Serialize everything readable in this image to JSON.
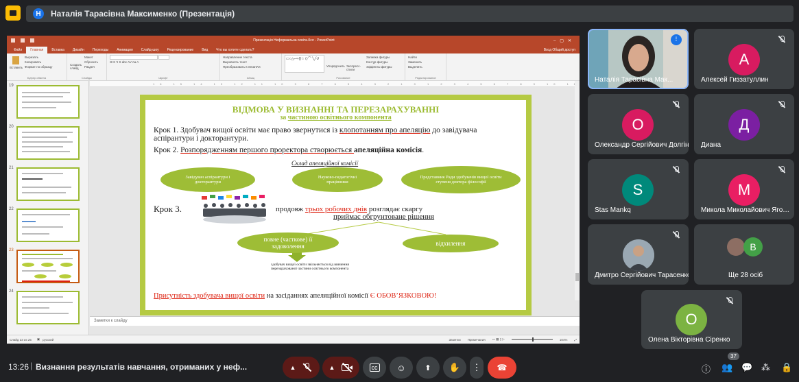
{
  "presenter": {
    "initial": "Н",
    "title": "Наталія Тарасівна Максименко (Презентація)"
  },
  "ppt": {
    "doc_title": "Презентація Неформальна освіта.Ксл - PowerPoint",
    "tabs": [
      "Файл",
      "Главная",
      "Вставка",
      "Дизайн",
      "Переходы",
      "Анимация",
      "Слайд-шоу",
      "Рецензирование",
      "Вид",
      "Что вы хотите сделать?"
    ],
    "tabs_right": "Вход  Общий доступ",
    "ribbon": {
      "paste": "Вставить",
      "cut": "Вырезать",
      "copy": "Копировать",
      "format_painter": "Формат по образцу",
      "clipboard_label": "Буфер обмена",
      "new_slide": "Создать слайд",
      "layout": "Макет",
      "reset": "Сбросить",
      "section": "Раздел",
      "slides_label": "Слайды",
      "font_label": "Шрифт",
      "text_direction": "Направление текста",
      "align_text": "Выровнять текст",
      "smartart": "Преобразовать в SmartArt",
      "paragraph_label": "Абзац",
      "arrange": "Упорядочить",
      "quick_styles": "Экспресс-стили",
      "shape_fill": "Заливка фигуры",
      "shape_outline": "Контур фигуры",
      "shape_effects": "Эффекты фигуры",
      "drawing_label": "Рисование",
      "find": "Найти",
      "replace": "Заменить",
      "select": "Выделить",
      "editing_label": "Редактирование"
    },
    "thumbs": [
      "19",
      "20",
      "21",
      "22",
      "23",
      "24"
    ],
    "notes_placeholder": "Заметки к слайду",
    "status_left": "Слайд 23 из 25",
    "status_lang": "русский",
    "status_notes": "Заметки",
    "status_comments": "Примечания",
    "status_zoom": "104%"
  },
  "slide": {
    "title": "ВІДМОВА У ВИЗНАННІ ТА ПЕРЕЗАРАХУВАННІ",
    "subtitle_prefix": "за ",
    "subtitle_underlined": "частиною освітнього компонента",
    "step1_a": "Крок 1. Здобувач вищої освіти має право звернутися із ",
    "step1_red": "клопотанням про апеляцію",
    "step1_b": " до завідувача",
    "step1_line2": "аспірантури і докторантури.",
    "step2_a": "Крок 2. ",
    "step2_b": "Розпорядженням першого проректора створюється ",
    "step2_bold": "апеляційна комісія",
    "step2_end": ".",
    "composition_title": "Склад апеляційної комісії",
    "ellipse1": "Завідувач аспірантури і докторантури",
    "ellipse2": "Науково-педагогічні працівники",
    "ellipse3": "Представник Ради здобувачів вищої освіти ступеня доктора філософії",
    "step3": "Крок 3.",
    "step3_a": "продовж ",
    "step3_red": "трьох робочих днів",
    "step3_b": " розглядає скаргу",
    "step3_line2": "приймає обгрунтоване рішення",
    "outcome1": "повне (часткове) її задоволення",
    "outcome2": "відхилення",
    "result_text": "здобувач вищої освіти звільняється від вивчення перезарахованої частини освітнього компонента",
    "footer_red": "Присутність здобувача вищої освіти",
    "footer_mid": " на засіданнях апеляційної комісії ",
    "footer_red2": "Є ОБОВ’ЯЗКОВОЮ!"
  },
  "participants": {
    "self": {
      "name": "Наталія Тарасівна Мак..."
    },
    "tiles": [
      {
        "initial": "А",
        "name": "Алексей Гиззатуллин",
        "color": "#d81b60"
      },
      {
        "initial": "О",
        "name": "Олександр Сергійович Долгін",
        "color": "#d81b60"
      },
      {
        "initial": "Д",
        "name": "Диана",
        "color": "#7b1fa2"
      },
      {
        "initial": "S",
        "name": "Stas Mankq",
        "color": "#00897b"
      },
      {
        "initial": "М",
        "name": "Микола Миколайович Ягольник",
        "color": "#e91e63"
      },
      {
        "initial": "",
        "name": "Дмитро Сергійович Тарасенко"
      },
      {
        "initial": "В",
        "name": "Ще 28 осіб",
        "color": "#43a047"
      },
      {
        "initial": "О",
        "name": "Олена Вікторівна Сіренко",
        "color": "#7cb342"
      }
    ]
  },
  "bottom": {
    "time": "13:26",
    "separator": "|",
    "meeting_title": "Визнання результатів навчання, отриманих у неф...",
    "people_count": "37"
  }
}
